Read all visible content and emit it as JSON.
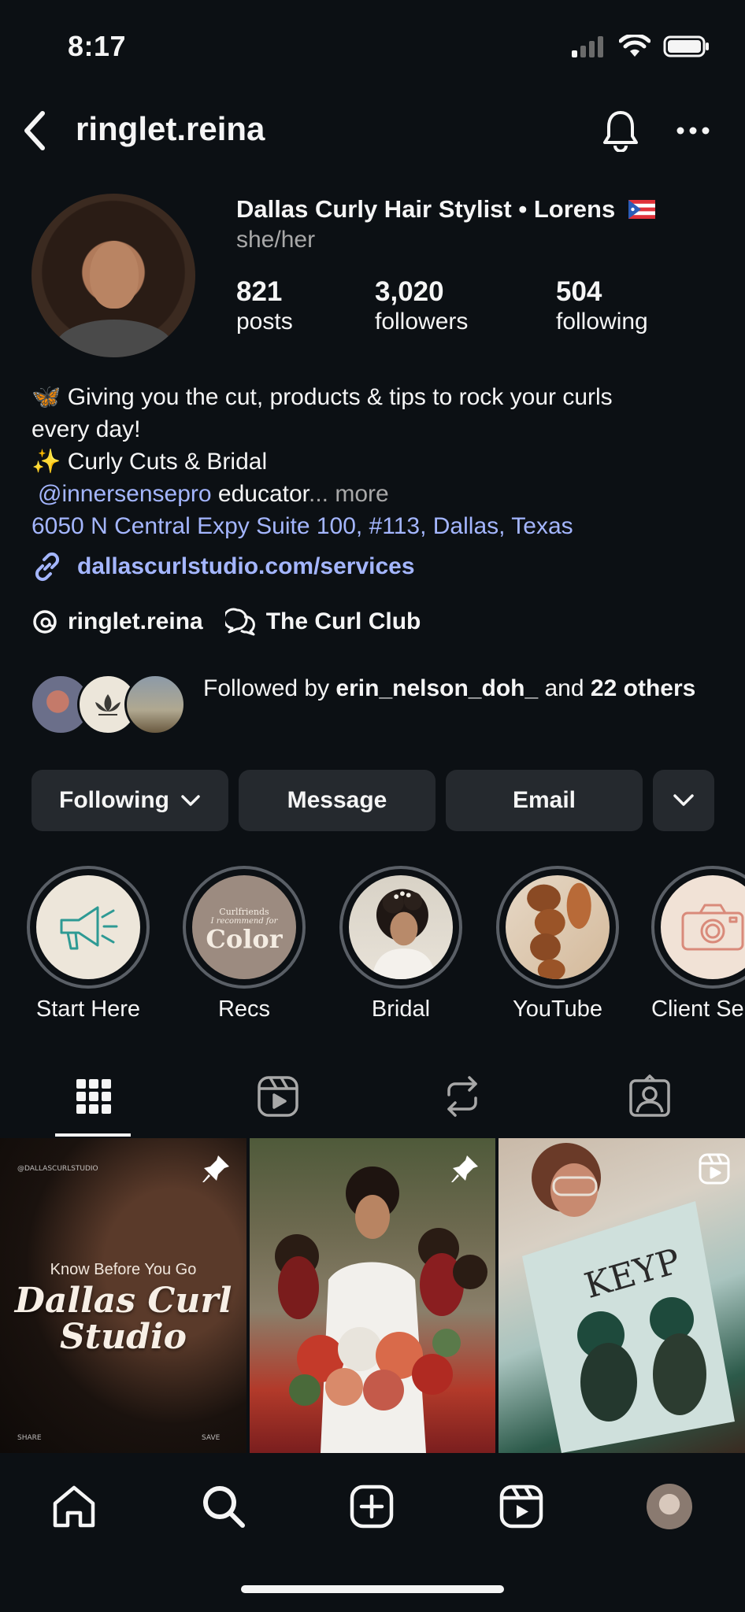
{
  "status_bar": {
    "time": "8:17"
  },
  "header": {
    "username": "ringlet.reina"
  },
  "profile": {
    "display_name": "Dallas Curly Hair Stylist • Lorens",
    "pronouns": "she/her",
    "stats": [
      {
        "value": "821",
        "label": "posts"
      },
      {
        "value": "3,020",
        "label": "followers"
      },
      {
        "value": "504",
        "label": "following"
      }
    ]
  },
  "bio": {
    "line1_emoji": "🦋",
    "line1": "Giving you the cut, products & tips to rock your curls",
    "line2": "every day!",
    "line3_emoji": "✨",
    "line3": "Curly Cuts & Bridal",
    "mention": "@innersensepro",
    "line4_rest": "educator",
    "ellipsis": "...",
    "more": "more",
    "address": "6050 N Central Expy Suite 100, #113, Dallas, Texas",
    "link": "dallascurlstudio.com/services"
  },
  "chips": {
    "threads": "ringlet.reina",
    "channel": "The Curl Club"
  },
  "followed_by": {
    "prefix": "Followed by",
    "name": "erin_nelson_doh_",
    "middle": "and",
    "count": "22",
    "suffix": "others"
  },
  "actions": {
    "following": "Following",
    "message": "Message",
    "email": "Email"
  },
  "highlights": [
    {
      "label": "Start Here",
      "icon": "megaphone-icon"
    },
    {
      "label": "Recs",
      "text_small": "Curlfriends",
      "text_small2": "I recommend for",
      "text_big": "Color"
    },
    {
      "label": "Bridal"
    },
    {
      "label": "YouTube"
    },
    {
      "label": "Client Sel",
      "icon": "camera-icon"
    }
  ],
  "posts": [
    {
      "handle": "@DALLASCURLSTUDIO",
      "kicker": "Know Before You Go",
      "title_line1": "Dallas Curl",
      "title_line2": "Studio",
      "share": "SHARE",
      "save": "SAVE",
      "pinned": true
    },
    {
      "pinned": true
    },
    {
      "sign_text": "KEYP",
      "type": "reel"
    }
  ],
  "colors": {
    "background": "#0c1014",
    "link": "#a4b6ff",
    "button": "#25292e",
    "secondary_text": "#a8a8a8"
  }
}
